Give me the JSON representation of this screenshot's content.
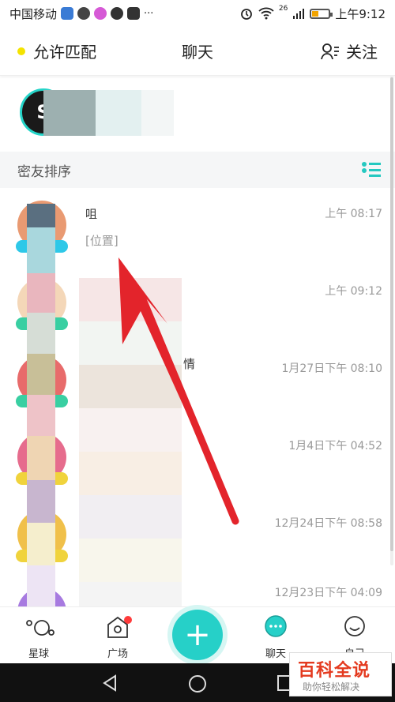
{
  "status_bar": {
    "carrier": "中国移动",
    "signal_badge": "26",
    "time": "上午9:12",
    "more": "···"
  },
  "header": {
    "left_label": "允许匹配",
    "title": "聊天",
    "right_label": "关注"
  },
  "section": {
    "title": "密友排序"
  },
  "chats": [
    {
      "name": "咀",
      "preview": "[位置]",
      "time": "上午 08:17",
      "tag_color": "#2ec8e8",
      "avatar_color": "#e99a72"
    },
    {
      "name": "",
      "preview": "",
      "time": "上午 09:12",
      "tag_color": "#39cfa2",
      "avatar_color": "#f4d7b8"
    },
    {
      "name": "",
      "preview": "情",
      "time": "1月27日下午 08:10",
      "tag_color": "#39cfa2",
      "avatar_color": "#e86b6b"
    },
    {
      "name": "",
      "preview": "",
      "time": "1月4日下午 04:52",
      "tag_color": "#f0d33c",
      "avatar_color": "#e66c8d"
    },
    {
      "name": "",
      "preview": "",
      "time": "12月24日下午 08:58",
      "tag_color": "#f0d33c",
      "avatar_color": "#f0c04a"
    },
    {
      "name": "",
      "preview": "",
      "time": "12月23日下午 04:09",
      "tag_color": "#9b6be0",
      "avatar_color": "#a77ae0"
    }
  ],
  "bottom_nav": {
    "planet": "星球",
    "square": "广场",
    "chat": "聊天",
    "me": "自己"
  },
  "watermark": {
    "title": "百科全说",
    "subtitle": "助你轻松解决"
  },
  "colors": {
    "accent": "#26d0c8",
    "arrow": "#e3242b",
    "match_dot": "#f4e300"
  }
}
